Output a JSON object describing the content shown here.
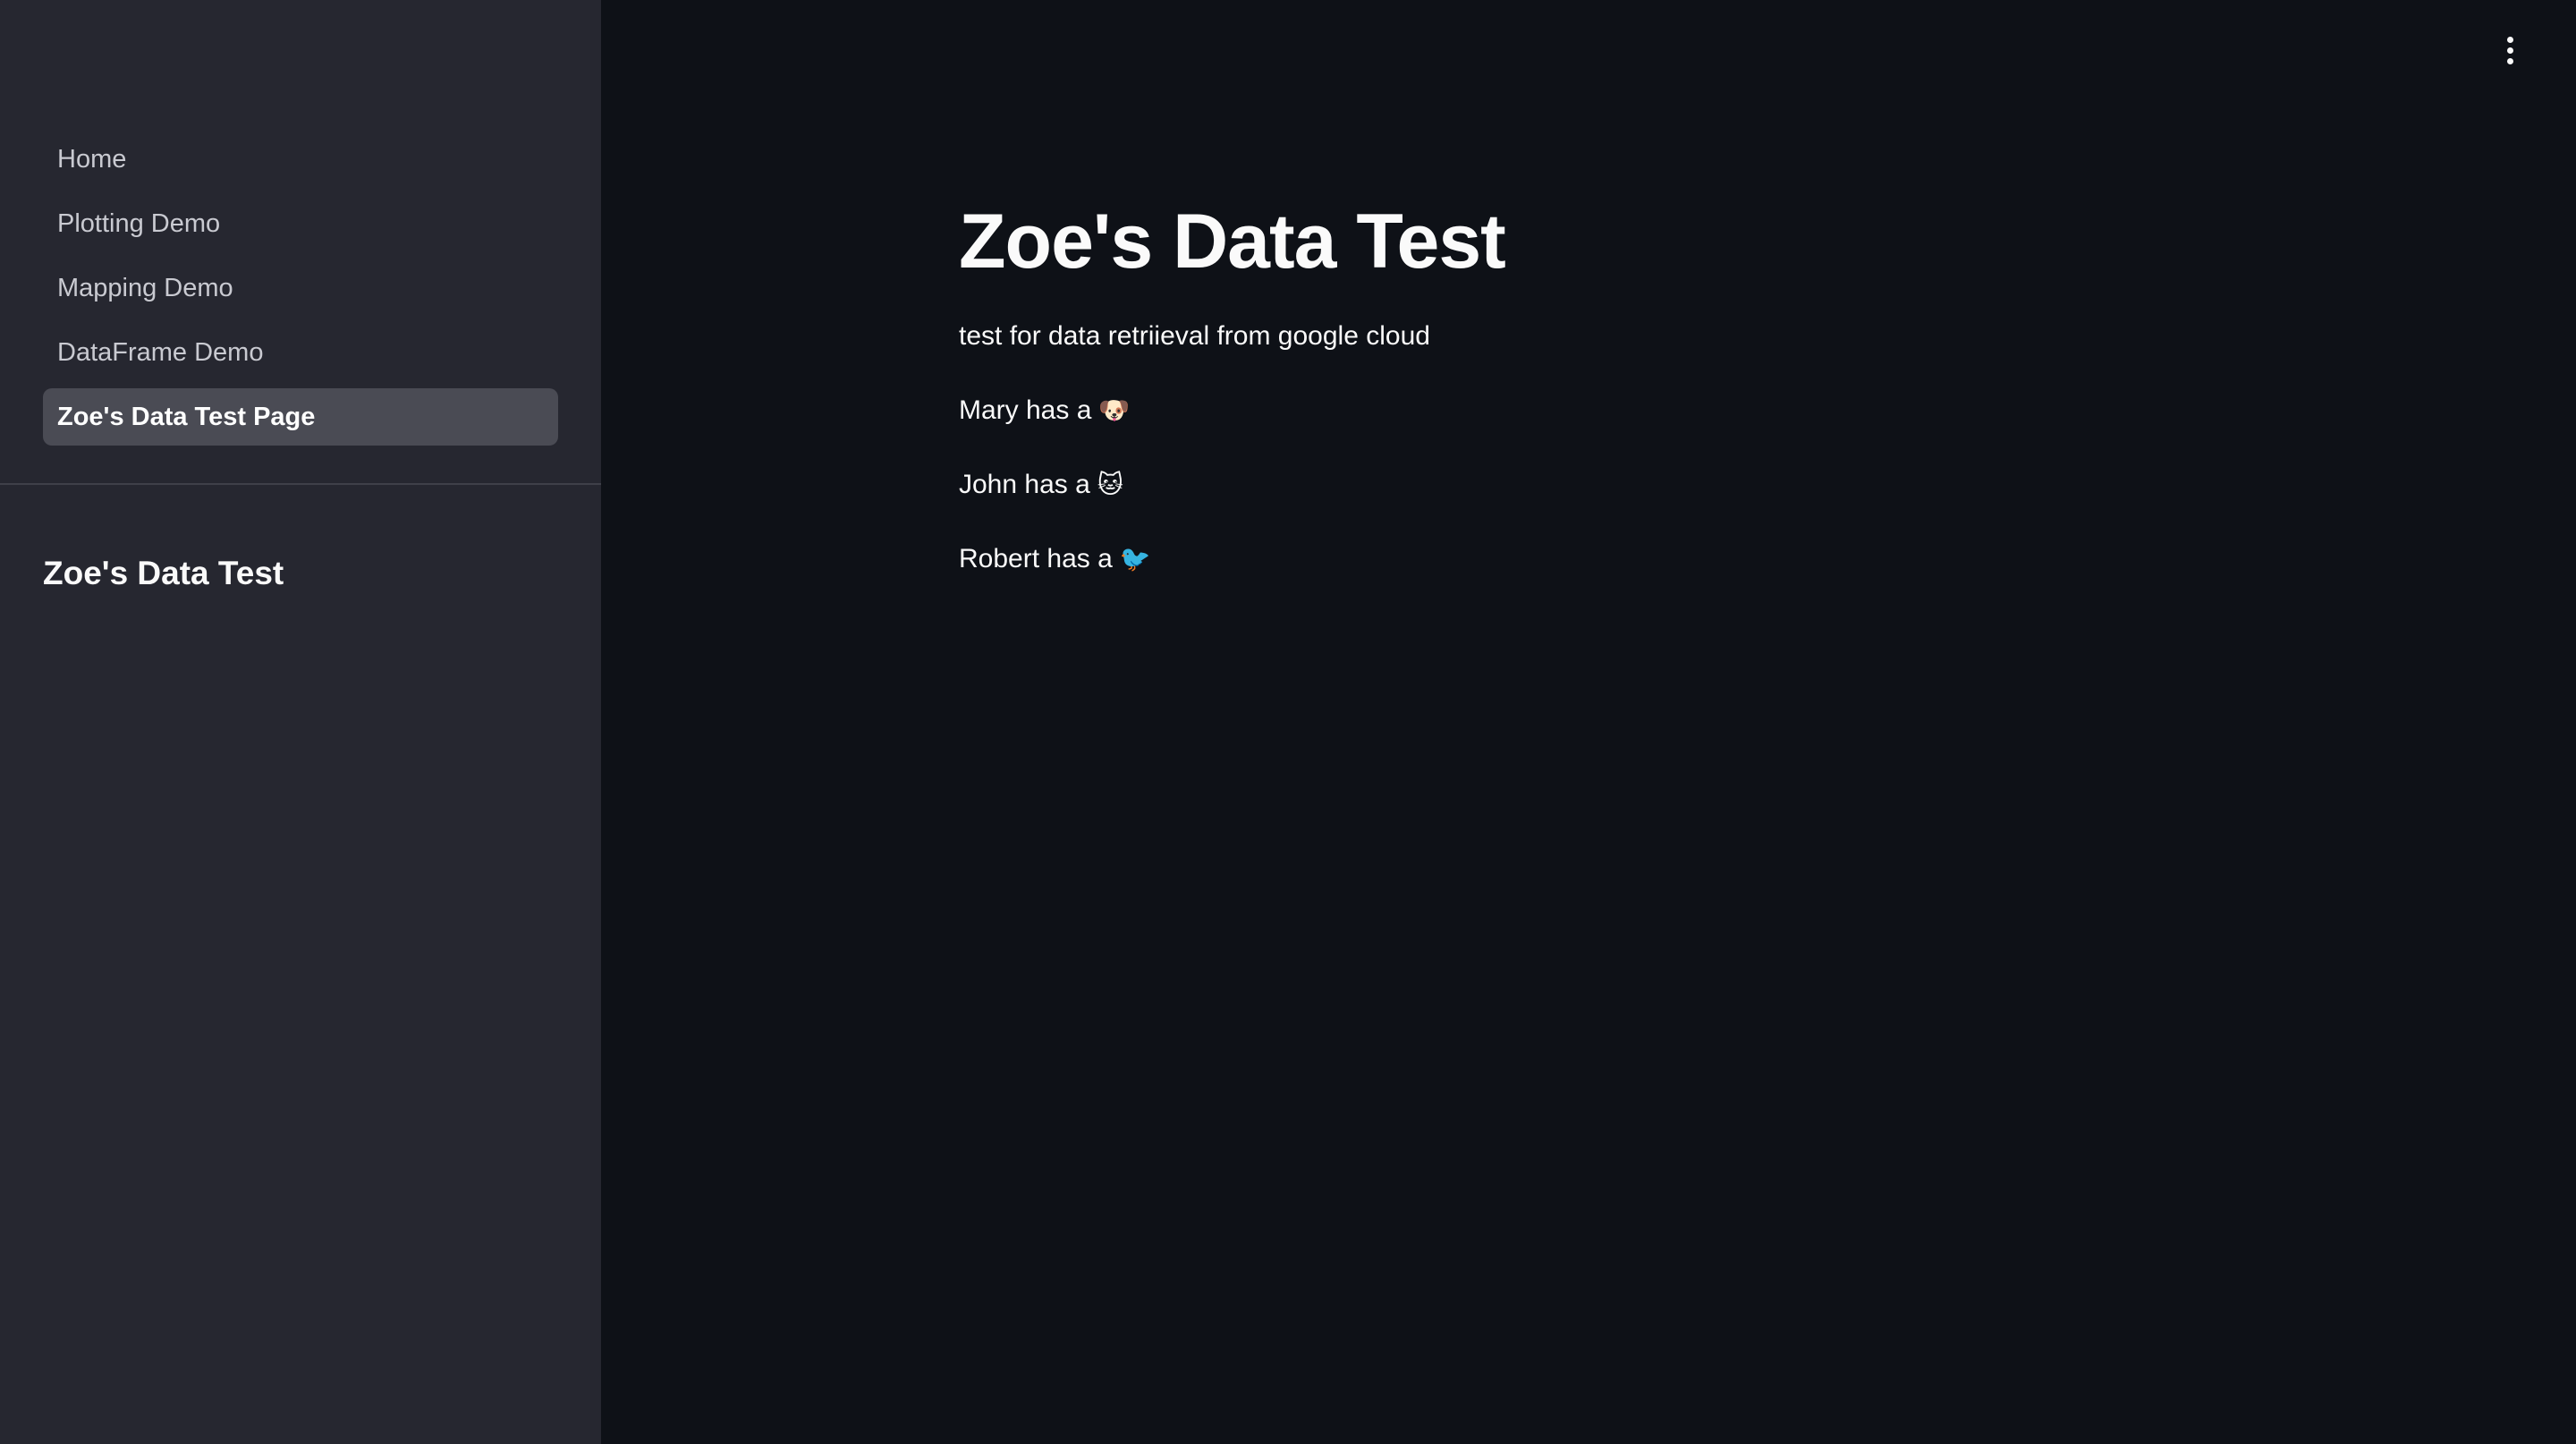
{
  "sidebar": {
    "nav_items": [
      {
        "label": "Home",
        "active": false
      },
      {
        "label": "Plotting Demo",
        "active": false
      },
      {
        "label": "Mapping Demo",
        "active": false
      },
      {
        "label": "DataFrame Demo",
        "active": false
      },
      {
        "label": "Zoe's Data Test Page",
        "active": true
      }
    ],
    "title": "Zoe's Data Test"
  },
  "header": {
    "menu_icon": "vertical-ellipsis-icon"
  },
  "main": {
    "title": "Zoe's Data Test",
    "description": "test for data retriieval from google cloud",
    "pets": [
      {
        "text": "Mary has a",
        "emoji": "🐶",
        "icon": "dog-icon"
      },
      {
        "text": "John has a",
        "emoji": "🐱",
        "icon": "cat-icon"
      },
      {
        "text": "Robert has a",
        "emoji": "🐦",
        "icon": "bird-icon"
      }
    ]
  },
  "colors": {
    "main_background": "#0e1117",
    "sidebar_background": "#262730",
    "active_item_background": "#4a4b54",
    "text": "#fafafa"
  }
}
